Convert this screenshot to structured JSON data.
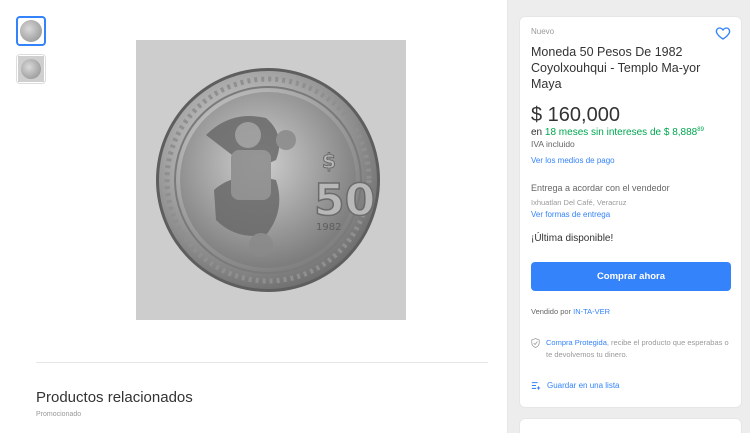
{
  "gallery": {
    "thumbnails": [
      "thumb-1",
      "thumb-2"
    ],
    "main_image": "coin-photo"
  },
  "related": {
    "title": "Productos relacionados",
    "promo": "Promocionado"
  },
  "product": {
    "condition": "Nuevo",
    "title": "Moneda 50 Pesos De 1982 Coyolxouhqui - Templo Ma-yor Maya",
    "price": "$ 160,000",
    "installments_prefix": "en ",
    "installments_highlight": "18 meses sin intereses de $ 8,888",
    "installments_cents": "89",
    "iva": "IVA incluido",
    "payment_link": "Ver los medios de pago",
    "delivery": "Entrega a acordar con el vendedor",
    "location": "Ixhuatlan Del Café, Veracruz",
    "shipping_link": "Ver formas de entrega",
    "stock": "¡Última disponible!",
    "buy_button": "Comprar ahora",
    "seller_prefix": "Vendido por ",
    "seller_name": "IN-TA-VER",
    "protect_link": "Compra Protegida",
    "protect_text": ", recibe el producto que esperabas o te devolvemos tu dinero.",
    "save_link": "Guardar en una lista"
  },
  "colors": {
    "accent": "#3483fa",
    "green": "#00a650"
  }
}
